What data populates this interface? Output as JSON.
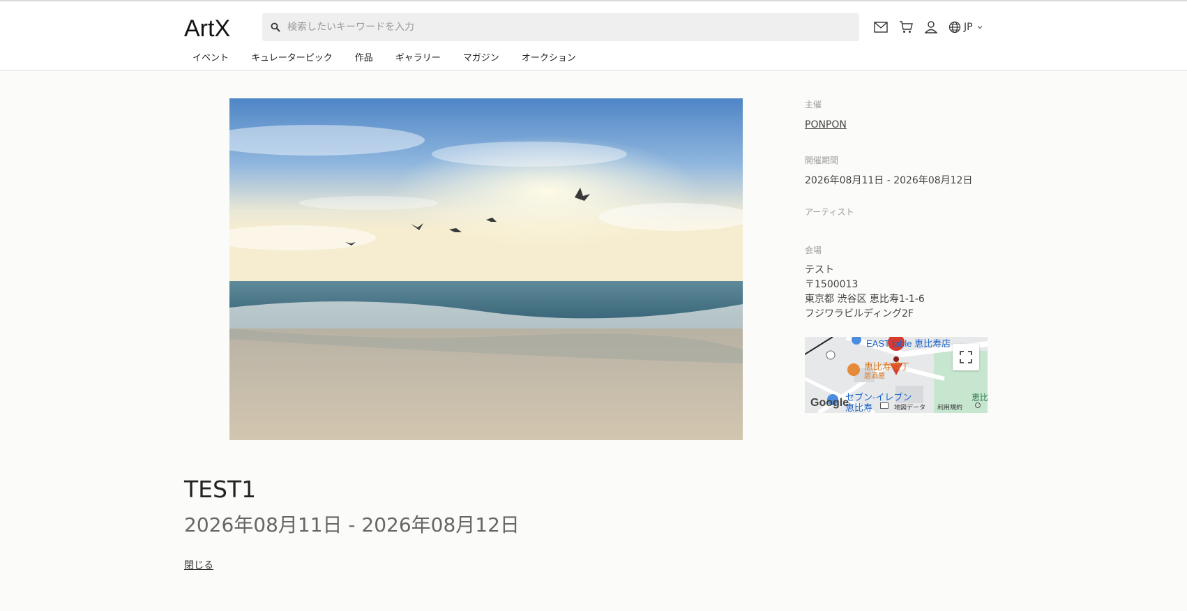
{
  "header": {
    "logo_text": "ArtX",
    "search_placeholder": "検索したいキーワードを入力",
    "icons": [
      "mail-icon",
      "cart-icon",
      "user-icon",
      "globe-icon"
    ],
    "language": "JP"
  },
  "nav": {
    "items": [
      "イベント",
      "キュレーターピック",
      "作品",
      "ギャラリー",
      "マガジン",
      "オークション"
    ]
  },
  "event": {
    "title": "TEST1",
    "dates": "2026年08月11日 - 2026年08月12日",
    "close_label": "閉じる"
  },
  "sidebar": {
    "organizer_label": "主催",
    "organizer_name": "PONPON",
    "period_label": "開催期間",
    "period_value": "2026年08月11日 - 2026年08月12日",
    "artist_label": "アーティスト",
    "venue_label": "会場",
    "venue_name": "テスト",
    "venue_postal": "〒1500013",
    "venue_address": "東京都 渋谷区 恵比寿1-1-6",
    "venue_building": "フジワラビルディング2F"
  },
  "map": {
    "poi_1": "EAST table 恵比寿店",
    "poi_2": "恵比寿横丁",
    "poi_2_sub": "居酒屋",
    "poi_3": "セブン-イレブン",
    "poi_3_sub": "恵比寿",
    "poi_4": "恵比",
    "google": "Google",
    "map_data": "地図データ",
    "terms": "利用規約"
  },
  "colors": {
    "accent": "#222222",
    "map_pin": "#d93a2f"
  }
}
